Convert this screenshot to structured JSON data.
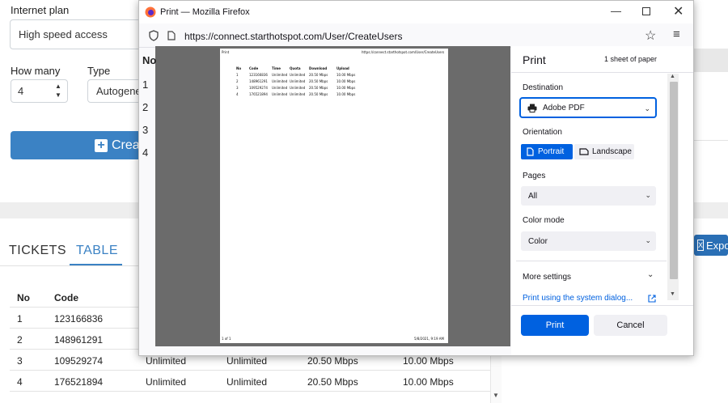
{
  "bg": {
    "internet_plan_label": "Internet plan",
    "internet_plan_value": "High speed access",
    "how_many_label": "How many",
    "how_many_value": "4",
    "type_label": "Type",
    "type_value": "Autogene",
    "create_label": "Creat",
    "tabs": [
      "TICKETS",
      "TABLE"
    ],
    "export_label": "Expo",
    "side_header": "No",
    "side_numbers": [
      "1",
      "2",
      "3",
      "4"
    ],
    "columns": {
      "no": "No",
      "code": "Code"
    },
    "rows": [
      {
        "no": "1",
        "code": "123166836",
        "time": "",
        "quota": "",
        "download": "",
        "upload": ""
      },
      {
        "no": "2",
        "code": "148961291",
        "time": "",
        "quota": "",
        "download": "",
        "upload": ""
      },
      {
        "no": "3",
        "code": "109529274",
        "time": "Unlimited",
        "quota": "Unlimited",
        "download": "20.50 Mbps",
        "upload": "10.00 Mbps"
      },
      {
        "no": "4",
        "code": "176521894",
        "time": "Unlimited",
        "quota": "Unlimited",
        "download": "20.50 Mbps",
        "upload": "10.00 Mbps"
      }
    ]
  },
  "firefox": {
    "title": "Print — Mozilla Firefox",
    "url": "https://connect.starthotspot.com/User/CreateUsers"
  },
  "preview": {
    "header_left": "Print",
    "header_right": "https://connect.starthotspot.com/User/CreateUsers",
    "columns": [
      "No",
      "Code",
      "Time",
      "Quota",
      "Download",
      "Upload"
    ],
    "rows": [
      [
        "1",
        "123166836",
        "Unlimited",
        "Unlimited",
        "20.50 Mbps",
        "10.00 Mbps"
      ],
      [
        "2",
        "148961291",
        "Unlimited",
        "Unlimited",
        "20.50 Mbps",
        "10.00 Mbps"
      ],
      [
        "3",
        "109529274",
        "Unlimited",
        "Unlimited",
        "20.50 Mbps",
        "10.00 Mbps"
      ],
      [
        "4",
        "176521894",
        "Unlimited",
        "Unlimited",
        "20.50 Mbps",
        "10.00 Mbps"
      ]
    ],
    "footer_left": "1 of 1",
    "footer_right": "5/8/2021, 9:19 AM"
  },
  "print_settings": {
    "title": "Print",
    "sheet_count": "1 sheet of paper",
    "destination_label": "Destination",
    "destination_value": "Adobe PDF",
    "orientation_label": "Orientation",
    "portrait_label": "Portrait",
    "landscape_label": "Landscape",
    "pages_label": "Pages",
    "pages_value": "All",
    "color_mode_label": "Color mode",
    "color_mode_value": "Color",
    "more_settings_label": "More settings",
    "system_dialog_label": "Print using the system dialog...",
    "print_button": "Print",
    "cancel_button": "Cancel"
  },
  "colors": {
    "accent": "#0061e0",
    "app_blue": "#3b82c4"
  }
}
